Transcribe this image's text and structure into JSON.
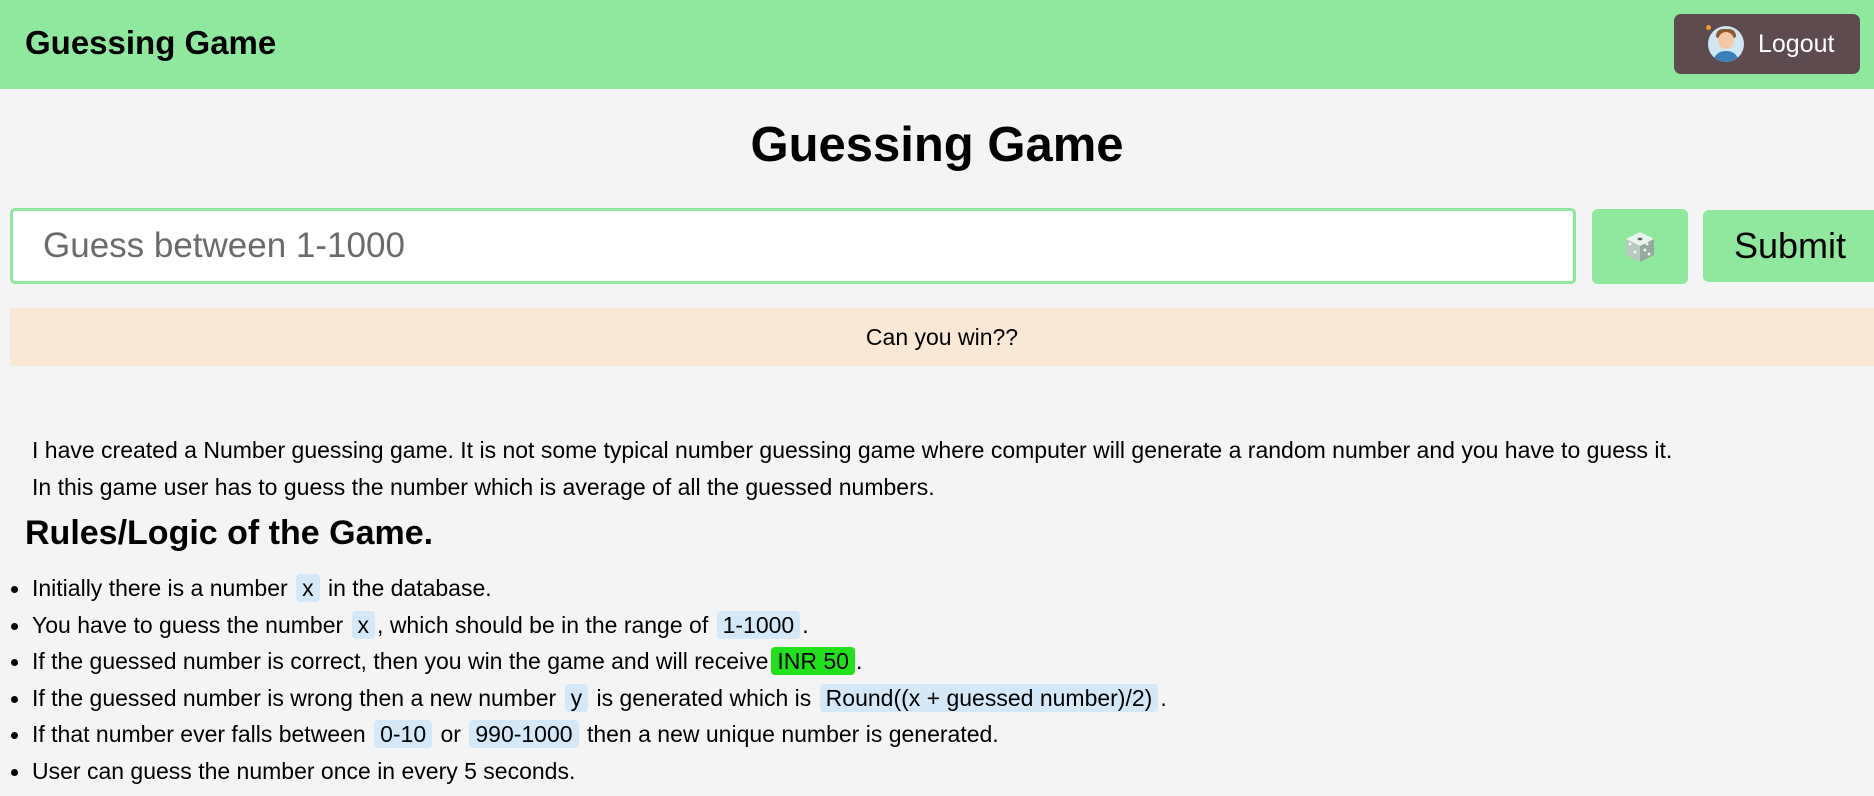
{
  "navbar": {
    "brand": "Guessing Game",
    "logout_label": "Logout",
    "avatar_icon": "user-avatar-icon"
  },
  "main": {
    "title": "Guessing Game",
    "input_placeholder": "Guess between 1-1000",
    "input_value": "",
    "dice_icon": "dice-icon",
    "submit_label": "Submit",
    "status_text": "Can you win??"
  },
  "description": {
    "line1": "I have created a Number guessing game. It is not some typical number guessing game where computer will generate a random number and you have to guess it.",
    "line2": "In this game user has to guess the number which is average of all the guessed numbers."
  },
  "rules": {
    "title": "Rules/Logic of the Game.",
    "r1": {
      "a": "Initially there is a number",
      "code1": "x",
      "b": "in the database."
    },
    "r2": {
      "a": "You have to guess the number",
      "code1": "x",
      "b": ", which should be in the range of",
      "code2": "1-1000",
      "c": "."
    },
    "r3": {
      "a": "If the guessed number is correct, then you win the game and will receive",
      "prize": "INR 50",
      "b": "."
    },
    "r4": {
      "a": "If the guessed number is wrong then a new number",
      "code1": "y",
      "b": "is generated which is",
      "code2": "Round((x + guessed number)/2)",
      "c": "."
    },
    "r5": {
      "a": "If that number ever falls between",
      "code1": "0-10",
      "b": "or",
      "code2": "990-1000",
      "c": "then a new unique number is generated."
    },
    "r6": {
      "a": "User can guess the number once in every 5 seconds."
    }
  },
  "colors": {
    "accent_green": "#8fe89e",
    "logout_bg": "#5e4b4f",
    "banner_bg": "#f9e8d6",
    "code_bg": "#d4e8f8",
    "prize_bg": "#22e01c"
  }
}
